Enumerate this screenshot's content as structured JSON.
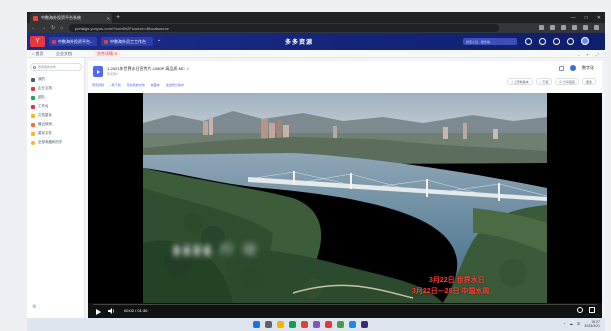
{
  "browser": {
    "tab_title": "中数海外投资平台系统",
    "new_tab": "+",
    "url": "portalgs.yonyou.com/?vcml%2Fsource=4floodsource",
    "window_controls": [
      "—",
      "□",
      "✕"
    ]
  },
  "app": {
    "logo_text": "Y",
    "header_buttons": [
      "中数海外投资平台...",
      "中数海外员工工作台"
    ],
    "chevron": "⌄",
    "center_logo": "多多资源",
    "search_placeholder": "搜索人员、服务等"
  },
  "nav_tabs": [
    {
      "label": "⌂ 首页",
      "active": false
    },
    {
      "label": "企业文档",
      "active": false
    },
    {
      "label": "文件详情 ✕",
      "active": true
    }
  ],
  "nav_right": [
    "⌄",
    "⇤",
    "⤢"
  ],
  "sidebar": {
    "search_placeholder": "搜索我的文件",
    "items": [
      {
        "label": "我的",
        "color": "#4e5969"
      },
      {
        "label": "企业文档",
        "color": "#e8383d"
      },
      {
        "label": "团队",
        "color": "#1fa463"
      },
      {
        "label": "工作台",
        "color": "#e8383d"
      },
      {
        "label": "文档星标",
        "color": "#f7ba1e"
      },
      {
        "label": "最近使用",
        "color": "#f77234"
      },
      {
        "label": "星标文件",
        "color": "#f7ba1e"
      },
      {
        "label": "全部收藏和历史",
        "color": "#f7ba1e"
      }
    ],
    "footer_icon": "⚙"
  },
  "file": {
    "title": "1-2021年世界水日宣传片-1080P 高品质-MC ☆",
    "subtitle": "暂无简介",
    "actions": [
      "预览视频",
      "+收下载",
      "写在我的文档",
      "收藏夹",
      "发送到分组中"
    ],
    "owner_name": "数字化",
    "buttons": [
      "+ 上传新版本",
      "↓ 下载",
      "⊘ 分享链接",
      "更多"
    ]
  },
  "video": {
    "blur_text": "▮▮▮▮ 行 动",
    "caption1": "3月22日  世界水日",
    "caption2": "3月22日—28日  中国水周",
    "time": "00:02 / 01:30"
  },
  "taskbar": {
    "tray_items": [
      "^",
      "☁",
      "中"
    ],
    "time": "16:27",
    "date": "2023/3/21"
  }
}
